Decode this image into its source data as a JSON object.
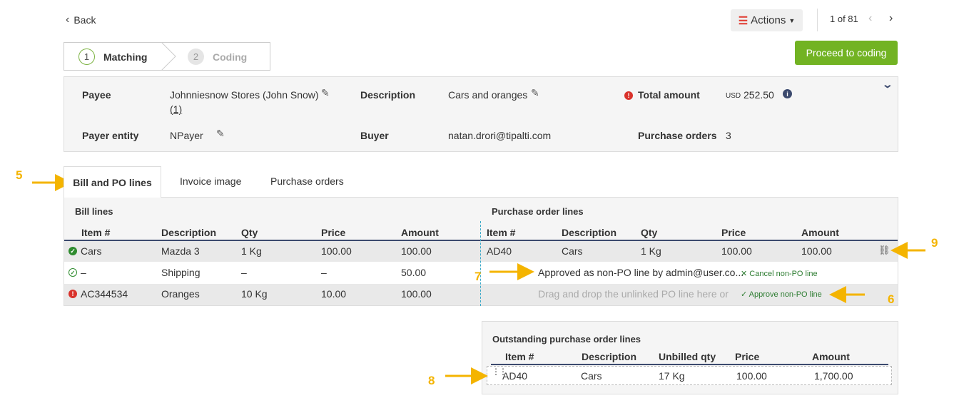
{
  "header": {
    "back_label": "Back",
    "actions_label": "Actions",
    "pager_text": "1 of 81"
  },
  "steps": [
    {
      "num": "1",
      "label": "Matching"
    },
    {
      "num": "2",
      "label": "Coding"
    }
  ],
  "proceed_label": "Proceed to coding",
  "info": {
    "payee_label": "Payee",
    "payee_value": "Johnniesnow Stores (John Snow)",
    "payee_link": "(1)",
    "payer_label": "Payer entity",
    "payer_value": "NPayer",
    "desc_label": "Description",
    "desc_value": "Cars and oranges",
    "buyer_label": "Buyer",
    "buyer_value": "natan.drori@tipalti.com",
    "total_label": "Total amount",
    "total_currency": "USD",
    "total_value": "252.50",
    "po_label": "Purchase orders",
    "po_value": "3"
  },
  "tabs": [
    "Bill and PO lines",
    "Invoice image",
    "Purchase orders"
  ],
  "bill": {
    "title": "Bill lines",
    "columns": [
      "Item #",
      "Description",
      "Qty",
      "Price",
      "Amount"
    ],
    "rows": [
      {
        "item": "Cars",
        "desc": "Mazda 3",
        "qty": "1 Kg",
        "price": "100.00",
        "amount": "100.00"
      },
      {
        "item": "–",
        "desc": "Shipping",
        "qty": "–",
        "price": "–",
        "amount": "50.00"
      },
      {
        "item": "AC344534",
        "desc": "Oranges",
        "qty": "10 Kg",
        "price": "10.00",
        "amount": "100.00"
      }
    ]
  },
  "po": {
    "title": "Purchase order lines",
    "columns": [
      "Item #",
      "Description",
      "Qty",
      "Price",
      "Amount"
    ],
    "row1": {
      "item": "AD40",
      "desc": "Cars",
      "qty": "1 Kg",
      "price": "100.00",
      "amount": "100.00"
    },
    "approved_text": "Approved as non-PO line by admin@user.co...",
    "cancel_link": "Cancel non-PO line",
    "drag_text": "Drag and drop the unlinked PO line here or",
    "approve_link": "Approve non-PO line"
  },
  "outstanding": {
    "title": "Outstanding purchase order lines",
    "columns": [
      "Item #",
      "Description",
      "Unbilled qty",
      "Price",
      "Amount"
    ],
    "row": {
      "item": "AD40",
      "desc": "Cars",
      "qty": "17 Kg",
      "price": "100.00",
      "amount": "1,700.00"
    }
  },
  "annotations": [
    "5",
    "6",
    "7",
    "8",
    "9"
  ],
  "colors": {
    "accent_green": "#72b323",
    "annotation": "#f4b400",
    "error": "#d9322b",
    "header_line": "#3c4a6e"
  }
}
